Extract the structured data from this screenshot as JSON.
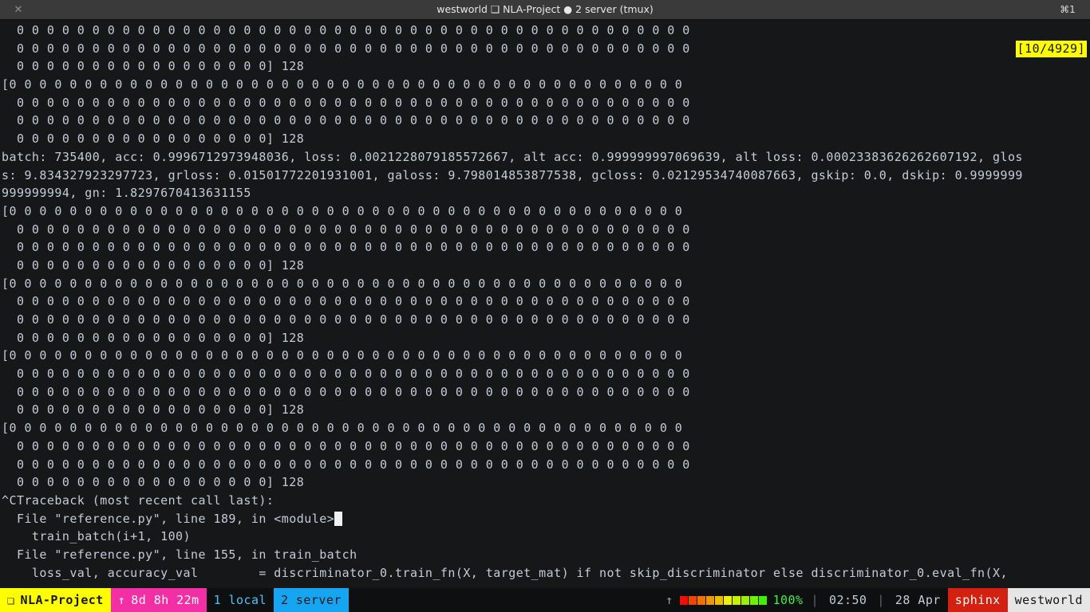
{
  "window": {
    "close_label": "✕",
    "close_icon": "close-icon",
    "title_host": "westworld",
    "title_glyph": "❑",
    "title_session": "NLA-Project",
    "title_dot": "●",
    "title_window": "2 server (tmux)",
    "title_full": "westworld ❑ NLA-Project ● 2 server (tmux)",
    "cmd_badge": "⌘1"
  },
  "terminal": {
    "scroll_indicator": "[10/4929]",
    "scroll_indicator_bg": "#ffff00",
    "background": "#151719",
    "foreground": "#c3ccd8",
    "cursor_color": "#f2f2f2",
    "lines": [
      {
        "text": "  0 0 0 0 0 0 0 0 0 0 0 0 0 0 0 0 0 0 0 0 0 0 0 0 0 0 0 0 0 0 0 0 0 0 0 0 0 0 0 0 0 0 0 0 0"
      },
      {
        "text": "  0 0 0 0 0 0 0 0 0 0 0 0 0 0 0 0 0 0 0 0 0 0 0 0 0 0 0 0 0 0 0 0 0 0 0 0 0 0 0 0 0 0 0 0 0"
      },
      {
        "text": "  0 0 0 0 0 0 0 0 0 0 0 0 0 0 0 0 0] 128"
      },
      {
        "text": "[0 0 0 0 0 0 0 0 0 0 0 0 0 0 0 0 0 0 0 0 0 0 0 0 0 0 0 0 0 0 0 0 0 0 0 0 0 0 0 0 0 0 0 0 0"
      },
      {
        "text": "  0 0 0 0 0 0 0 0 0 0 0 0 0 0 0 0 0 0 0 0 0 0 0 0 0 0 0 0 0 0 0 0 0 0 0 0 0 0 0 0 0 0 0 0 0"
      },
      {
        "text": "  0 0 0 0 0 0 0 0 0 0 0 0 0 0 0 0 0 0 0 0 0 0 0 0 0 0 0 0 0 0 0 0 0 0 0 0 0 0 0 0 0 0 0 0 0"
      },
      {
        "text": "  0 0 0 0 0 0 0 0 0 0 0 0 0 0 0 0 0] 128"
      },
      {
        "text": "batch: 735400, acc: 0.9996712973948036, loss: 0.0021228079185572667, alt acc: 0.999999997069639, alt loss: 0.00023383626262607192, glos"
      },
      {
        "text": "s: 9.834327923297723, grloss: 0.01501772201931001, galoss: 9.798014853877538, gcloss: 0.02129534740087663, gskip: 0.0, dskip: 0.9999999"
      },
      {
        "text": "999999994, gn: 1.8297670413631155"
      },
      {
        "text": "[0 0 0 0 0 0 0 0 0 0 0 0 0 0 0 0 0 0 0 0 0 0 0 0 0 0 0 0 0 0 0 0 0 0 0 0 0 0 0 0 0 0 0 0 0"
      },
      {
        "text": "  0 0 0 0 0 0 0 0 0 0 0 0 0 0 0 0 0 0 0 0 0 0 0 0 0 0 0 0 0 0 0 0 0 0 0 0 0 0 0 0 0 0 0 0 0"
      },
      {
        "text": "  0 0 0 0 0 0 0 0 0 0 0 0 0 0 0 0 0 0 0 0 0 0 0 0 0 0 0 0 0 0 0 0 0 0 0 0 0 0 0 0 0 0 0 0 0"
      },
      {
        "text": "  0 0 0 0 0 0 0 0 0 0 0 0 0 0 0 0 0] 128"
      },
      {
        "text": "[0 0 0 0 0 0 0 0 0 0 0 0 0 0 0 0 0 0 0 0 0 0 0 0 0 0 0 0 0 0 0 0 0 0 0 0 0 0 0 0 0 0 0 0 0"
      },
      {
        "text": "  0 0 0 0 0 0 0 0 0 0 0 0 0 0 0 0 0 0 0 0 0 0 0 0 0 0 0 0 0 0 0 0 0 0 0 0 0 0 0 0 0 0 0 0 0"
      },
      {
        "text": "  0 0 0 0 0 0 0 0 0 0 0 0 0 0 0 0 0 0 0 0 0 0 0 0 0 0 0 0 0 0 0 0 0 0 0 0 0 0 0 0 0 0 0 0 0"
      },
      {
        "text": "  0 0 0 0 0 0 0 0 0 0 0 0 0 0 0 0 0] 128"
      },
      {
        "text": "[0 0 0 0 0 0 0 0 0 0 0 0 0 0 0 0 0 0 0 0 0 0 0 0 0 0 0 0 0 0 0 0 0 0 0 0 0 0 0 0 0 0 0 0 0"
      },
      {
        "text": "  0 0 0 0 0 0 0 0 0 0 0 0 0 0 0 0 0 0 0 0 0 0 0 0 0 0 0 0 0 0 0 0 0 0 0 0 0 0 0 0 0 0 0 0 0"
      },
      {
        "text": "  0 0 0 0 0 0 0 0 0 0 0 0 0 0 0 0 0 0 0 0 0 0 0 0 0 0 0 0 0 0 0 0 0 0 0 0 0 0 0 0 0 0 0 0 0"
      },
      {
        "text": "  0 0 0 0 0 0 0 0 0 0 0 0 0 0 0 0 0] 128"
      },
      {
        "text": "[0 0 0 0 0 0 0 0 0 0 0 0 0 0 0 0 0 0 0 0 0 0 0 0 0 0 0 0 0 0 0 0 0 0 0 0 0 0 0 0 0 0 0 0 0"
      },
      {
        "text": "  0 0 0 0 0 0 0 0 0 0 0 0 0 0 0 0 0 0 0 0 0 0 0 0 0 0 0 0 0 0 0 0 0 0 0 0 0 0 0 0 0 0 0 0 0"
      },
      {
        "text": "  0 0 0 0 0 0 0 0 0 0 0 0 0 0 0 0 0 0 0 0 0 0 0 0 0 0 0 0 0 0 0 0 0 0 0 0 0 0 0 0 0 0 0 0 0"
      },
      {
        "text": "  0 0 0 0 0 0 0 0 0 0 0 0 0 0 0 0 0] 128"
      },
      {
        "text": "^CTraceback (most recent call last):"
      },
      {
        "text": "  File \"reference.py\", line 189, in <module>",
        "cursor_after": true
      },
      {
        "text": "    train_batch(i+1, 100)"
      },
      {
        "text": "  File \"reference.py\", line 155, in train_batch"
      },
      {
        "text": "    loss_val, accuracy_val        = discriminator_0.train_fn(X, target_mat) if not skip_discriminator else discriminator_0.eval_fn(X,"
      }
    ]
  },
  "statusbar": {
    "session_icon": "❑",
    "session_name": "NLA-Project",
    "uptime_icon": "↑",
    "uptime": "8d 8h 22m",
    "windows": [
      {
        "label": "1 local",
        "active": false
      },
      {
        "label": "2 server",
        "active": true
      }
    ],
    "right_arrow": "↑",
    "battery_cells": [
      "#f01000",
      "#f04400",
      "#f07000",
      "#f09800",
      "#f0bc00",
      "#f0f000",
      "#c8f000",
      "#9ef000",
      "#6ef000",
      "#3ff000"
    ],
    "battery_percent": "100%",
    "sep": "|",
    "time": "02:50",
    "date": "28 Apr",
    "user": "sphinx",
    "host": "westworld"
  }
}
